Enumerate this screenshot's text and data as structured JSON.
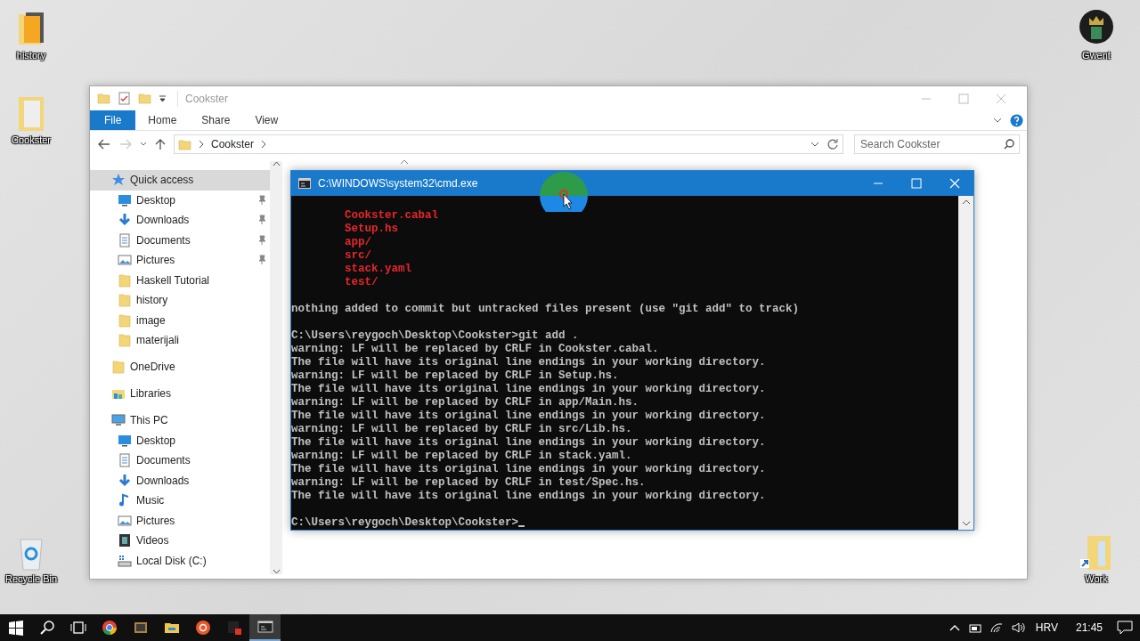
{
  "desktop_icons": [
    {
      "label": "history",
      "kind": "script-folder"
    },
    {
      "label": "Cookster",
      "kind": "folder"
    },
    {
      "label": "Recycle Bin",
      "kind": "recycle"
    },
    {
      "label": "Gwent",
      "kind": "game"
    },
    {
      "label": "Work",
      "kind": "folder-shortcut"
    }
  ],
  "explorer": {
    "title": "Cookster",
    "ribbon_tabs": [
      {
        "label": "File",
        "selected": true
      },
      {
        "label": "Home",
        "selected": false
      },
      {
        "label": "Share",
        "selected": false
      },
      {
        "label": "View",
        "selected": false
      }
    ],
    "path": [
      "Cookster"
    ],
    "search": {
      "placeholder": "Search Cookster"
    },
    "nav": [
      {
        "label": "Quick access",
        "kind": "star",
        "selected": true,
        "children": [
          {
            "label": "Desktop",
            "kind": "desktop",
            "pinned": true
          },
          {
            "label": "Downloads",
            "kind": "download",
            "pinned": true
          },
          {
            "label": "Documents",
            "kind": "document",
            "pinned": true
          },
          {
            "label": "Pictures",
            "kind": "picture",
            "pinned": true
          },
          {
            "label": "Haskell Tutorial",
            "kind": "folder",
            "pinned": false
          },
          {
            "label": "history",
            "kind": "folder",
            "pinned": false
          },
          {
            "label": "image",
            "kind": "folder",
            "pinned": false
          },
          {
            "label": "materijali",
            "kind": "folder",
            "pinned": false
          }
        ]
      },
      {
        "label": "OneDrive",
        "kind": "folder",
        "selected": false
      },
      {
        "label": "Libraries",
        "kind": "library",
        "selected": false
      },
      {
        "label": "This PC",
        "kind": "pc",
        "selected": false,
        "children": [
          {
            "label": "Desktop",
            "kind": "desktop",
            "pinned": false
          },
          {
            "label": "Documents",
            "kind": "document",
            "pinned": false
          },
          {
            "label": "Downloads",
            "kind": "download",
            "pinned": false
          },
          {
            "label": "Music",
            "kind": "music",
            "pinned": false
          },
          {
            "label": "Pictures",
            "kind": "picture",
            "pinned": false
          },
          {
            "label": "Videos",
            "kind": "video",
            "pinned": false
          },
          {
            "label": "Local Disk (C:)",
            "kind": "disk",
            "pinned": false
          }
        ]
      }
    ]
  },
  "cmd": {
    "title": "C:\\WINDOWS\\system32\\cmd.exe",
    "blocks": [
      {
        "kind": "untracked",
        "lines": [
          "Cookster.cabal",
          "Setup.hs",
          "app/",
          "src/",
          "stack.yaml",
          "test/"
        ]
      },
      {
        "kind": "output",
        "lines": [
          "nothing added to commit but untracked files present (use \"git add\" to track)"
        ]
      },
      {
        "kind": "output",
        "lines": [
          "C:\\Users\\reygoch\\Desktop\\Cookster>git add .",
          "warning: LF will be replaced by CRLF in Cookster.cabal.",
          "The file will have its original line endings in your working directory.",
          "warning: LF will be replaced by CRLF in Setup.hs.",
          "The file will have its original line endings in your working directory.",
          "warning: LF will be replaced by CRLF in app/Main.hs.",
          "The file will have its original line endings in your working directory.",
          "warning: LF will be replaced by CRLF in src/Lib.hs.",
          "The file will have its original line endings in your working directory.",
          "warning: LF will be replaced by CRLF in stack.yaml.",
          "The file will have its original line endings in your working directory.",
          "warning: LF will be replaced by CRLF in test/Spec.hs.",
          "The file will have its original line endings in your working directory."
        ]
      },
      {
        "kind": "prompt",
        "lines": [
          "C:\\Users\\reygoch\\Desktop\\Cookster>"
        ]
      }
    ]
  },
  "taskbar": {
    "apps": [
      {
        "kind": "chrome",
        "selected": false
      },
      {
        "kind": "app",
        "selected": false
      },
      {
        "kind": "explorer",
        "selected": false
      },
      {
        "kind": "orange",
        "selected": false
      },
      {
        "kind": "red",
        "selected": false
      },
      {
        "kind": "cmd",
        "selected": true
      }
    ],
    "language": "HRV",
    "time": "21:45"
  }
}
